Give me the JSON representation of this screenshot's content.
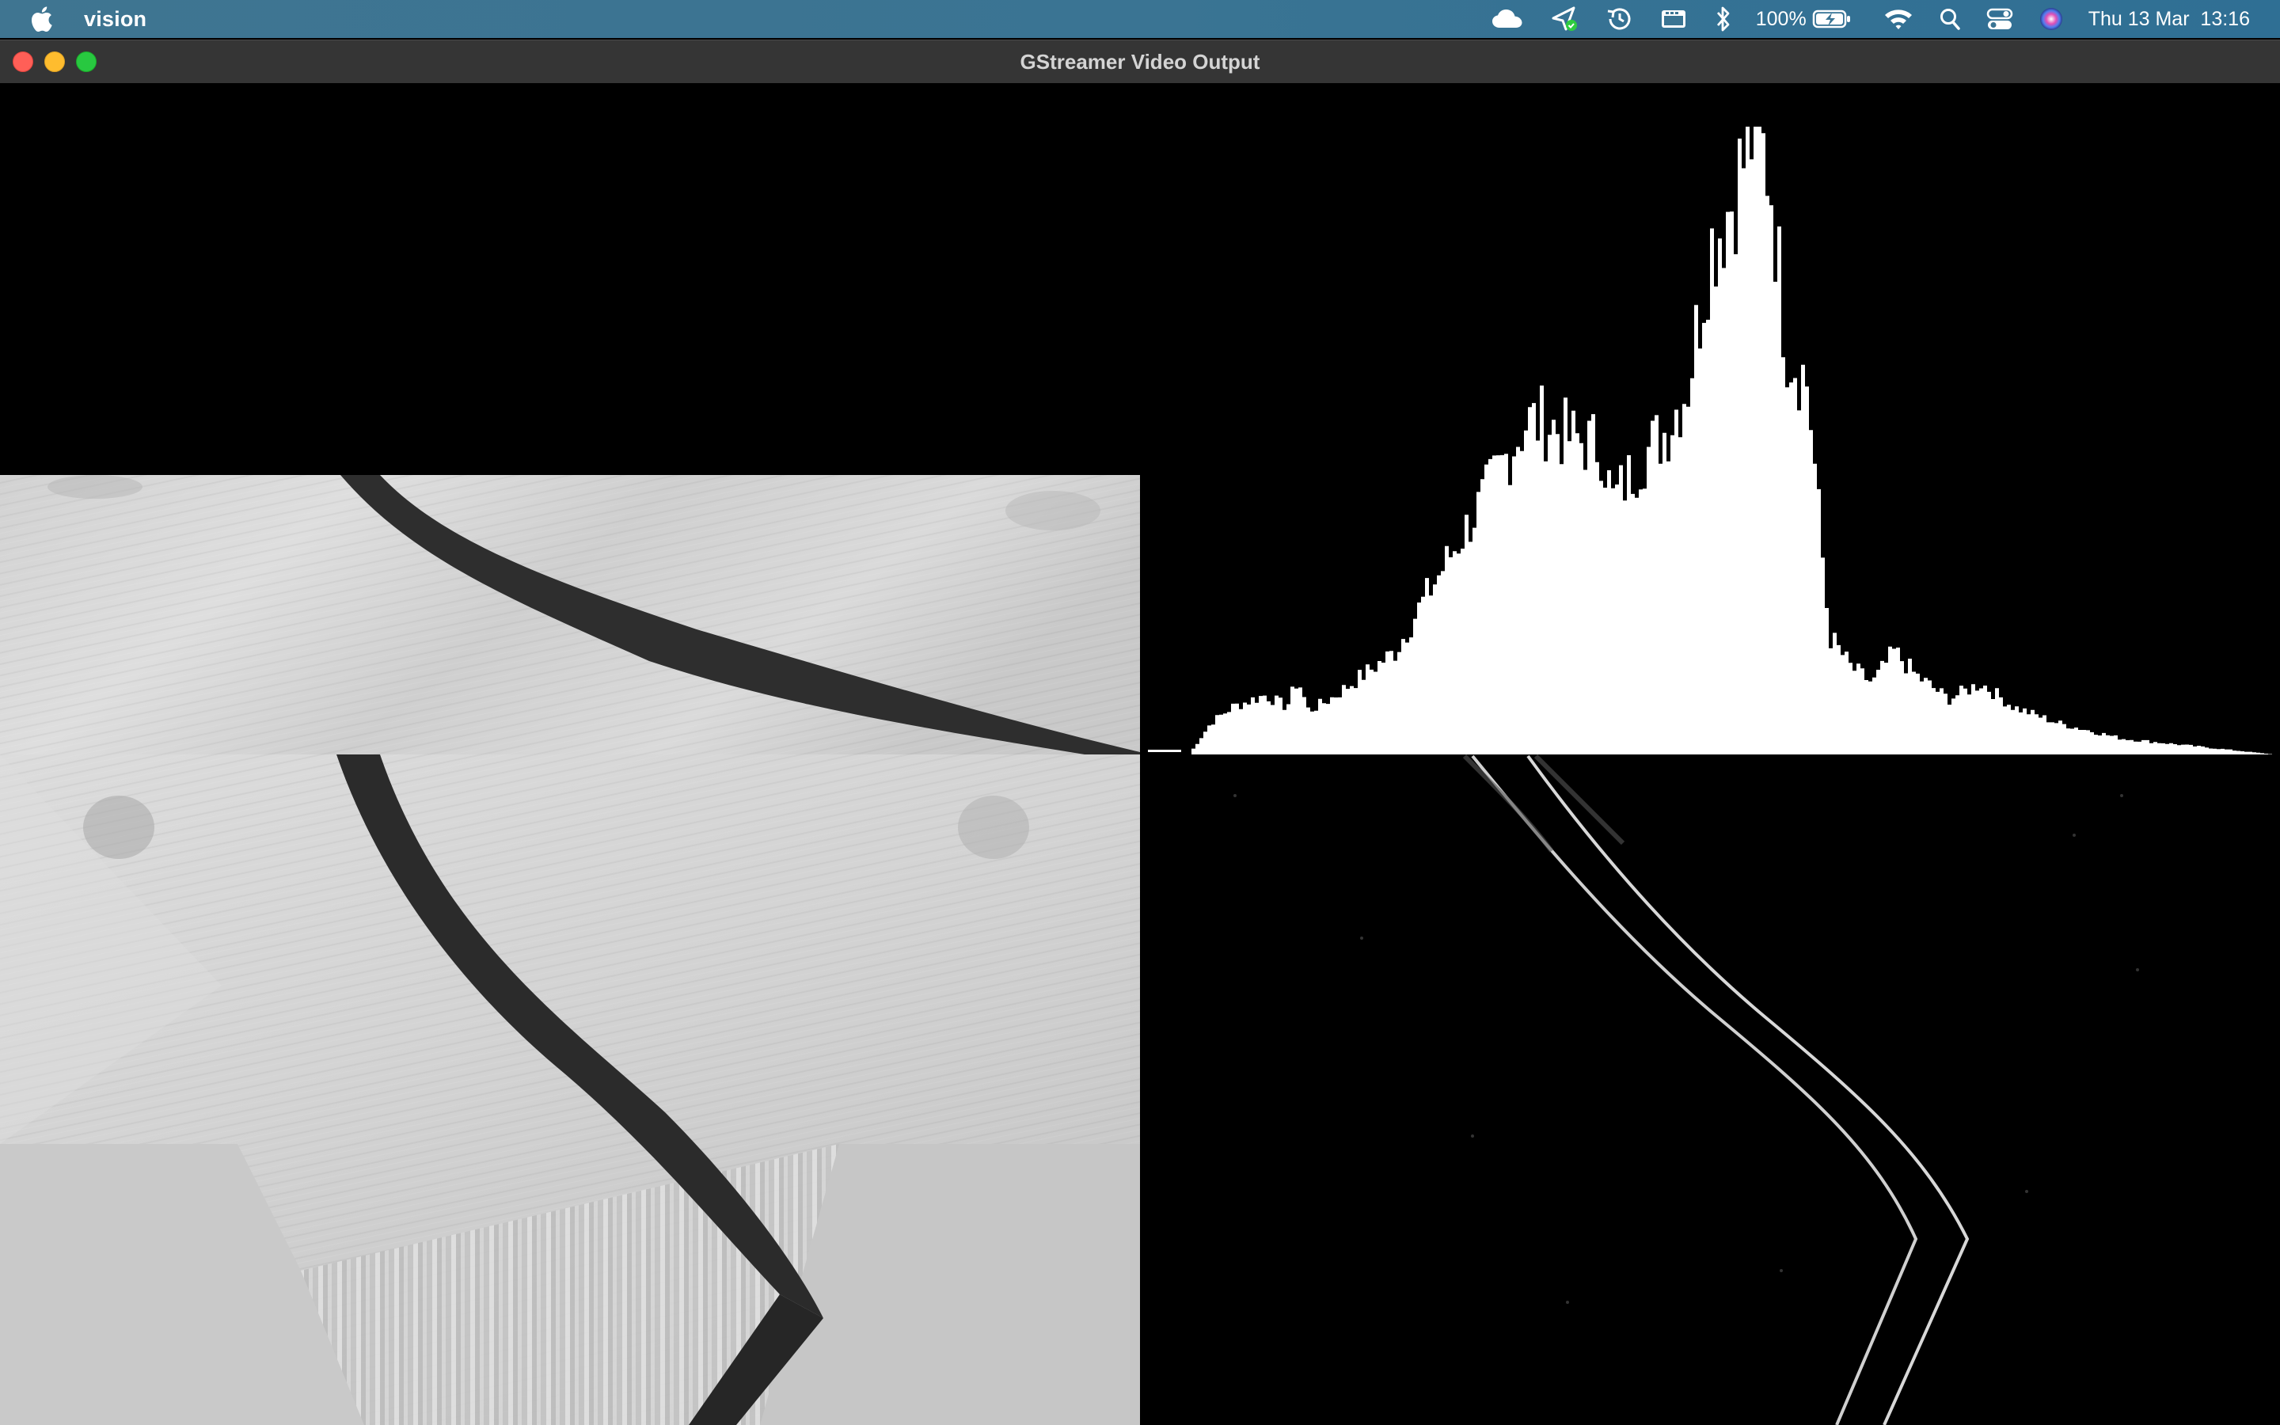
{
  "menubar": {
    "app_name": "vision",
    "battery_percent": "100%",
    "datetime": "Thu 13 Mar  13:16",
    "icons": [
      "apple-icon",
      "icloud-icon",
      "location-arrow-icon",
      "time-machine-icon",
      "display-icon",
      "bluetooth-icon",
      "battery-charging-icon",
      "wifi-icon",
      "spotlight-search-icon",
      "control-center-icon",
      "siri-icon"
    ]
  },
  "window": {
    "title": "GStreamer Video Output"
  },
  "colors": {
    "menubar": "#3a7493",
    "titlebar": "#353535",
    "close": "#ff5f57",
    "minimize": "#febc2e",
    "maximize": "#28c840"
  }
}
